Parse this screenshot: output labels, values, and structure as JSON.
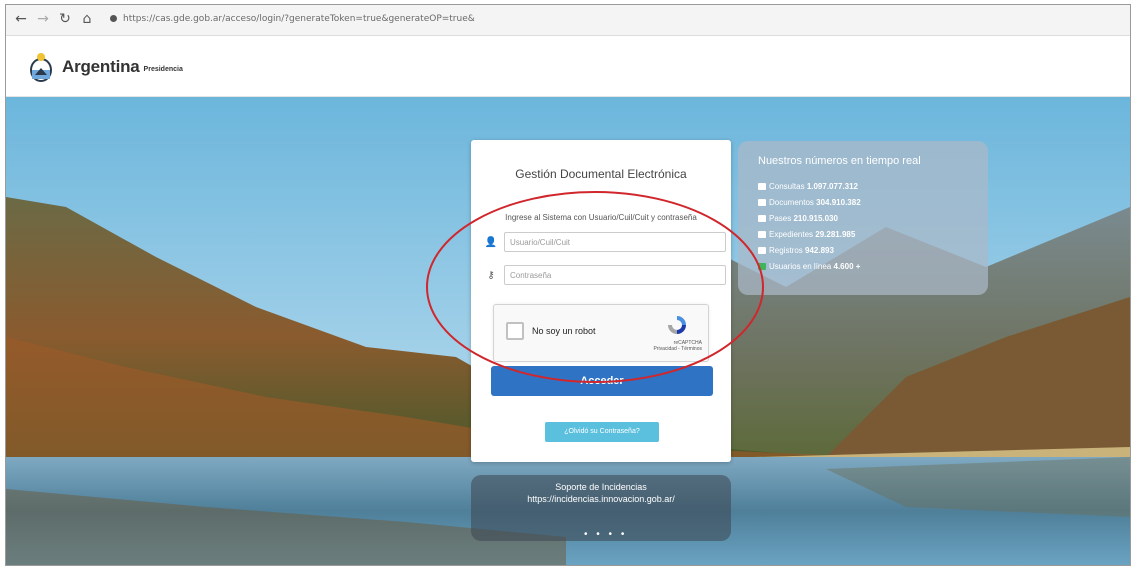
{
  "browser": {
    "back_icon": "arrow-left-icon",
    "forward_icon": "arrow-right-icon",
    "reload_icon": "reload-icon",
    "home_icon": "home-icon",
    "url": "https://cas.gde.gob.ar/acceso/login/?generateToken=true&generateOP=true&"
  },
  "header": {
    "brand": "Argentina",
    "brand_sub": "Presidencia"
  },
  "login": {
    "title": "Gestión Documental Electrónica",
    "subtitle": "Ingrese al Sistema con Usuario/Cuil/Cuit y contraseña",
    "user_placeholder": "Usuario/Cuil/Cuit",
    "password_placeholder": "Contraseña",
    "recaptcha_label": "No soy un robot",
    "recaptcha_brand": "reCAPTCHA",
    "recaptcha_links": "Privacidad - Términos",
    "submit_label": "Acceder",
    "forgot_label": "¿Olvidó su Contraseña?"
  },
  "stats": {
    "title": "Nuestros números en tiempo real",
    "items": [
      {
        "label": "Consultas",
        "value": "1.097.077.312",
        "icon": "chat-icon"
      },
      {
        "label": "Documentos",
        "value": "304.910.382",
        "icon": "document-icon"
      },
      {
        "label": "Pases",
        "value": "210.915.030",
        "icon": "transfer-icon"
      },
      {
        "label": "Expedientes",
        "value": "29.281.985",
        "icon": "folder-icon"
      },
      {
        "label": "Registros",
        "value": "942.893",
        "icon": "register-icon"
      },
      {
        "label": "Usuarios en línea",
        "value": "4.600 +",
        "icon": "online-user-icon"
      }
    ]
  },
  "support": {
    "title": "Soporte de Incidencias",
    "url": "https://incidencias.innovacion.gob.ar/"
  },
  "carousel_dots": "• • • •",
  "colors": {
    "primary_button": "#2f73c4",
    "secondary_button": "#5bc0de",
    "annotation": "#d0262c",
    "online_indicator": "#3eb55a"
  }
}
